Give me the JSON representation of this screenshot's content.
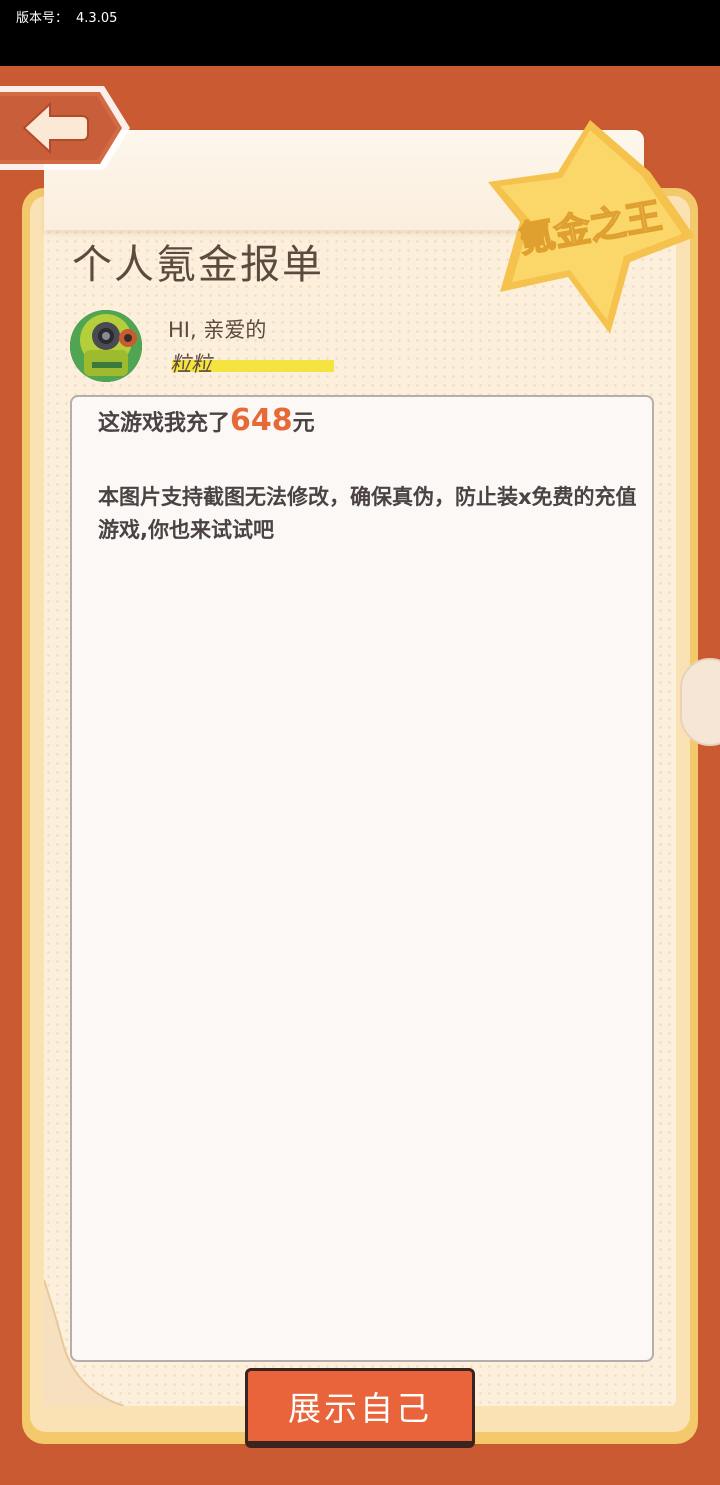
{
  "status_bar": {
    "version_label": "版本号：",
    "version_value": "4.3.05"
  },
  "header": {
    "title": "个人氪金报单",
    "badge_text": "氪金之王"
  },
  "user": {
    "greeting": "HI, 亲爱的",
    "name": "粒粒"
  },
  "report": {
    "prefix": "这游戏我充了",
    "amount": "648",
    "suffix": "元",
    "note": "本图片支持截图无法修改，确保真伪，防止装x免费的充值游戏,你也来试试吧"
  },
  "actions": {
    "show_button": "展示自己"
  },
  "colors": {
    "background": "#c95a31",
    "accent": "#e9643a",
    "amount": "#e56a37",
    "highlight": "#f4e341",
    "badge": "#f6c24e"
  },
  "icons": {
    "back": "back-arrow-icon",
    "avatar": "character-avatar"
  }
}
